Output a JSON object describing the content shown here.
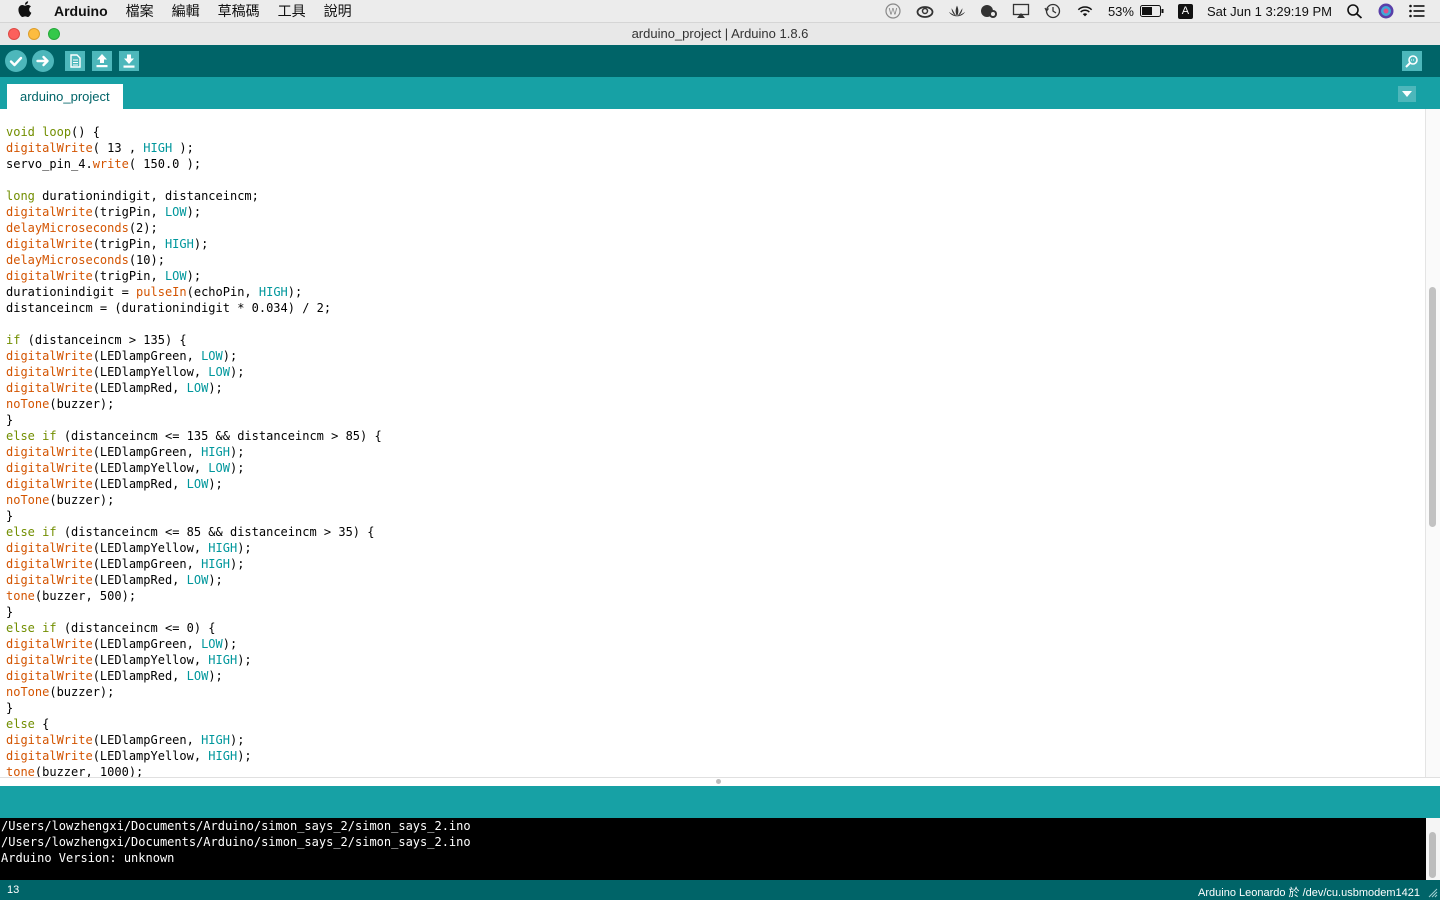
{
  "menubar": {
    "app_name": "Arduino",
    "menus": [
      "檔案",
      "編輯",
      "草稿碼",
      "工具",
      "說明"
    ],
    "battery_percent": "53%",
    "input_source": "A",
    "datetime": "Sat Jun 1  3:29:19 PM"
  },
  "window": {
    "title": "arduino_project | Arduino 1.8.6"
  },
  "tabs": [
    "arduino_project"
  ],
  "code_lines": [
    [
      [
        "k",
        "void"
      ],
      [
        "t",
        " "
      ],
      [
        "k",
        "loop"
      ],
      [
        "t",
        "() {"
      ]
    ],
    [
      [
        "f",
        "digitalWrite"
      ],
      [
        "t",
        "( 13 , "
      ],
      [
        "c",
        "HIGH"
      ],
      [
        "t",
        " );"
      ]
    ],
    [
      [
        "t",
        "servo_pin_4."
      ],
      [
        "f",
        "write"
      ],
      [
        "t",
        "( 150.0 );"
      ]
    ],
    [
      [
        "t",
        ""
      ]
    ],
    [
      [
        "k",
        "long"
      ],
      [
        "t",
        " durationindigit, distanceincm;"
      ]
    ],
    [
      [
        "f",
        "digitalWrite"
      ],
      [
        "t",
        "(trigPin, "
      ],
      [
        "c",
        "LOW"
      ],
      [
        "t",
        ");"
      ]
    ],
    [
      [
        "f",
        "delayMicroseconds"
      ],
      [
        "t",
        "(2);"
      ]
    ],
    [
      [
        "f",
        "digitalWrite"
      ],
      [
        "t",
        "(trigPin, "
      ],
      [
        "c",
        "HIGH"
      ],
      [
        "t",
        ");"
      ]
    ],
    [
      [
        "f",
        "delayMicroseconds"
      ],
      [
        "t",
        "(10);"
      ]
    ],
    [
      [
        "f",
        "digitalWrite"
      ],
      [
        "t",
        "(trigPin, "
      ],
      [
        "c",
        "LOW"
      ],
      [
        "t",
        ");"
      ]
    ],
    [
      [
        "t",
        "durationindigit = "
      ],
      [
        "f",
        "pulseIn"
      ],
      [
        "t",
        "(echoPin, "
      ],
      [
        "c",
        "HIGH"
      ],
      [
        "t",
        ");"
      ]
    ],
    [
      [
        "t",
        "distanceincm = (durationindigit * 0.034) / 2;"
      ]
    ],
    [
      [
        "t",
        ""
      ]
    ],
    [
      [
        "k",
        "if"
      ],
      [
        "t",
        " (distanceincm > 135) {"
      ]
    ],
    [
      [
        "f",
        "digitalWrite"
      ],
      [
        "t",
        "(LEDlampGreen, "
      ],
      [
        "c",
        "LOW"
      ],
      [
        "t",
        ");"
      ]
    ],
    [
      [
        "f",
        "digitalWrite"
      ],
      [
        "t",
        "(LEDlampYellow, "
      ],
      [
        "c",
        "LOW"
      ],
      [
        "t",
        ");"
      ]
    ],
    [
      [
        "f",
        "digitalWrite"
      ],
      [
        "t",
        "(LEDlampRed, "
      ],
      [
        "c",
        "LOW"
      ],
      [
        "t",
        ");"
      ]
    ],
    [
      [
        "f",
        "noTone"
      ],
      [
        "t",
        "(buzzer);"
      ]
    ],
    [
      [
        "t",
        "}"
      ]
    ],
    [
      [
        "k",
        "else"
      ],
      [
        "t",
        " "
      ],
      [
        "k",
        "if"
      ],
      [
        "t",
        " (distanceincm <= 135 && distanceincm > 85) {"
      ]
    ],
    [
      [
        "f",
        "digitalWrite"
      ],
      [
        "t",
        "(LEDlampGreen, "
      ],
      [
        "c",
        "HIGH"
      ],
      [
        "t",
        ");"
      ]
    ],
    [
      [
        "f",
        "digitalWrite"
      ],
      [
        "t",
        "(LEDlampYellow, "
      ],
      [
        "c",
        "LOW"
      ],
      [
        "t",
        ");"
      ]
    ],
    [
      [
        "f",
        "digitalWrite"
      ],
      [
        "t",
        "(LEDlampRed, "
      ],
      [
        "c",
        "LOW"
      ],
      [
        "t",
        ");"
      ]
    ],
    [
      [
        "f",
        "noTone"
      ],
      [
        "t",
        "(buzzer);"
      ]
    ],
    [
      [
        "t",
        "}"
      ]
    ],
    [
      [
        "k",
        "else"
      ],
      [
        "t",
        " "
      ],
      [
        "k",
        "if"
      ],
      [
        "t",
        " (distanceincm <= 85 && distanceincm > 35) {"
      ]
    ],
    [
      [
        "f",
        "digitalWrite"
      ],
      [
        "t",
        "(LEDlampYellow, "
      ],
      [
        "c",
        "HIGH"
      ],
      [
        "t",
        ");"
      ]
    ],
    [
      [
        "f",
        "digitalWrite"
      ],
      [
        "t",
        "(LEDlampGreen, "
      ],
      [
        "c",
        "HIGH"
      ],
      [
        "t",
        ");"
      ]
    ],
    [
      [
        "f",
        "digitalWrite"
      ],
      [
        "t",
        "(LEDlampRed, "
      ],
      [
        "c",
        "LOW"
      ],
      [
        "t",
        ");"
      ]
    ],
    [
      [
        "f",
        "tone"
      ],
      [
        "t",
        "(buzzer, 500);"
      ]
    ],
    [
      [
        "t",
        "}"
      ]
    ],
    [
      [
        "k",
        "else"
      ],
      [
        "t",
        " "
      ],
      [
        "k",
        "if"
      ],
      [
        "t",
        " (distanceincm <= 0) {"
      ]
    ],
    [
      [
        "f",
        "digitalWrite"
      ],
      [
        "t",
        "(LEDlampGreen, "
      ],
      [
        "c",
        "LOW"
      ],
      [
        "t",
        ");"
      ]
    ],
    [
      [
        "f",
        "digitalWrite"
      ],
      [
        "t",
        "(LEDlampYellow, "
      ],
      [
        "c",
        "HIGH"
      ],
      [
        "t",
        ");"
      ]
    ],
    [
      [
        "f",
        "digitalWrite"
      ],
      [
        "t",
        "(LEDlampRed, "
      ],
      [
        "c",
        "LOW"
      ],
      [
        "t",
        ");"
      ]
    ],
    [
      [
        "f",
        "noTone"
      ],
      [
        "t",
        "(buzzer);"
      ]
    ],
    [
      [
        "t",
        "}"
      ]
    ],
    [
      [
        "k",
        "else"
      ],
      [
        "t",
        " {"
      ]
    ],
    [
      [
        "f",
        "digitalWrite"
      ],
      [
        "t",
        "(LEDlampGreen, "
      ],
      [
        "c",
        "HIGH"
      ],
      [
        "t",
        ");"
      ]
    ],
    [
      [
        "f",
        "digitalWrite"
      ],
      [
        "t",
        "(LEDlampYellow, "
      ],
      [
        "c",
        "HIGH"
      ],
      [
        "t",
        ");"
      ]
    ],
    [
      [
        "f",
        "tone"
      ],
      [
        "t",
        "(buzzer, 1000);"
      ]
    ]
  ],
  "console_lines": [
    "/Users/lowzhengxi/Documents/Arduino/simon_says_2/simon_says_2.ino",
    "/Users/lowzhengxi/Documents/Arduino/simon_says_2/simon_says_2.ino",
    "Arduino Version: unknown"
  ],
  "statusbar": {
    "line_number": "13",
    "board_info": "Arduino Leonardo 於 /dev/cu.usbmodem1421"
  },
  "colors": {
    "toolbar": "#006468",
    "tabbar": "#17a1a5",
    "keyword": "#728e00",
    "function": "#d35400",
    "constant": "#00979c"
  },
  "icons": [
    "apple-icon",
    "verify-icon",
    "upload-icon",
    "new-icon",
    "open-icon",
    "save-icon",
    "serial-monitor-icon",
    "tab-menu-icon",
    "wifi-icon",
    "battery-icon",
    "spotlight-icon",
    "siri-icon",
    "notification-center-icon"
  ]
}
